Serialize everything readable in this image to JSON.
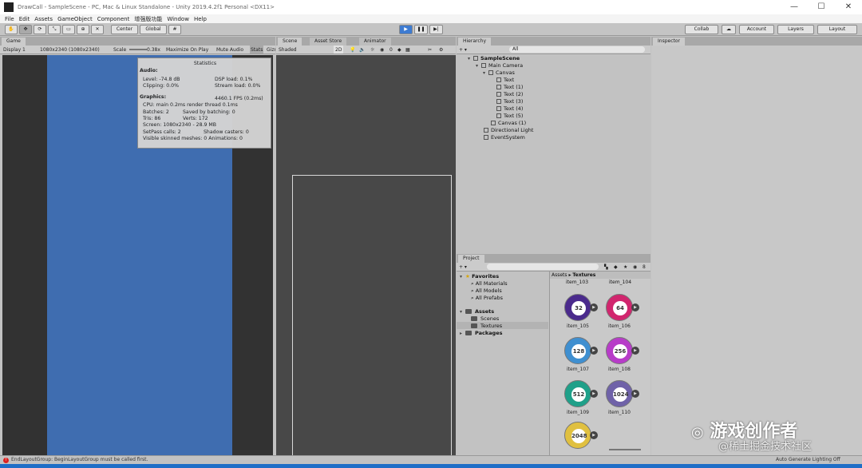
{
  "window": {
    "title": "DrawCall - SampleScene - PC, Mac & Linux Standalone - Unity 2019.4.2f1 Personal <DX11>",
    "minimize": "—",
    "maximize": "☐",
    "close": "✕"
  },
  "menu": [
    "File",
    "Edit",
    "Assets",
    "GameObject",
    "Component",
    "增强版功能",
    "Window",
    "Help"
  ],
  "toolbar": {
    "center": "Center",
    "global": "Global",
    "collab": "Collab",
    "account": "Account",
    "layers": "Layers",
    "layout": "Layout"
  },
  "game": {
    "tab": "Game",
    "display": "Display 1",
    "resolution": "1080x2340 (1080x2340)",
    "scale_label": "Scale",
    "scale_value": "0.38x",
    "maximize": "Maximize On Play",
    "mute": "Mute Audio",
    "stats": "Stats",
    "gizmos": "Gizmos"
  },
  "stats": {
    "title": "Statistics",
    "audio": "Audio:",
    "level": "Level: -74.8 dB",
    "clipping": "Clipping: 0.0%",
    "dsp": "DSP load: 0.1%",
    "stream": "Stream load: 0.0%",
    "graphics": "Graphics:",
    "fps": "4460.1 FPS (0.2ms)",
    "cpu": "CPU: main 0.2ms  render thread 0.1ms",
    "batches": "Batches: 2",
    "saved": "Saved by batching: 0",
    "tris": "Tris: 86",
    "verts": "Verts: 172",
    "screen": "Screen: 1080x2340 - 28.9 MB",
    "setpass": "SetPass calls: 2",
    "shadow": "Shadow casters: 0",
    "skinned": "Visible skinned meshes: 0  Animations: 0"
  },
  "scene": {
    "tabs": [
      "Scene",
      "Asset Store",
      "Animator"
    ],
    "shading": "Shaded",
    "mode": "2D",
    "hidden": "0"
  },
  "hierarchy": {
    "tab": "Hierarchy",
    "search": "All",
    "items": [
      "SampleScene",
      "Main Camera",
      "Canvas",
      "Text",
      "Text (1)",
      "Text (2)",
      "Text (3)",
      "Text (4)",
      "Text (5)",
      "Canvas (1)",
      "Directional Light",
      "EventSystem"
    ]
  },
  "inspector": {
    "tab": "Inspector"
  },
  "project": {
    "tab": "Project",
    "hidden_count": "8",
    "favorites": "Favorites",
    "fav_items": [
      "All Materials",
      "All Models",
      "All Prefabs"
    ],
    "assets": "Assets",
    "asset_items": [
      "Scenes",
      "Textures"
    ],
    "packages": "Packages",
    "breadcrumb": [
      "Assets",
      "Textures"
    ],
    "top_labels": [
      "item_103",
      "item_104"
    ],
    "textures": [
      {
        "num": "32",
        "label": "item_105",
        "color": "#4a2a8c"
      },
      {
        "num": "64",
        "label": "item_106",
        "color": "#d1266e"
      },
      {
        "num": "128",
        "label": "item_107",
        "color": "#3f8fd0"
      },
      {
        "num": "256",
        "label": "item_108",
        "color": "#b73cc8"
      },
      {
        "num": "512",
        "label": "item_109",
        "color": "#1fa089"
      },
      {
        "num": "1024",
        "label": "item_110",
        "color": "#6f62a8"
      },
      {
        "num": "2048",
        "label": "",
        "color": "#e0c040"
      }
    ]
  },
  "status": {
    "error": "EndLayoutGroup: BeginLayoutGroup must be called first.",
    "lighting": "Auto Generate Lighting Off"
  },
  "watermark": "游戏创作者",
  "watermark2": "@稀土掘金技术社区"
}
